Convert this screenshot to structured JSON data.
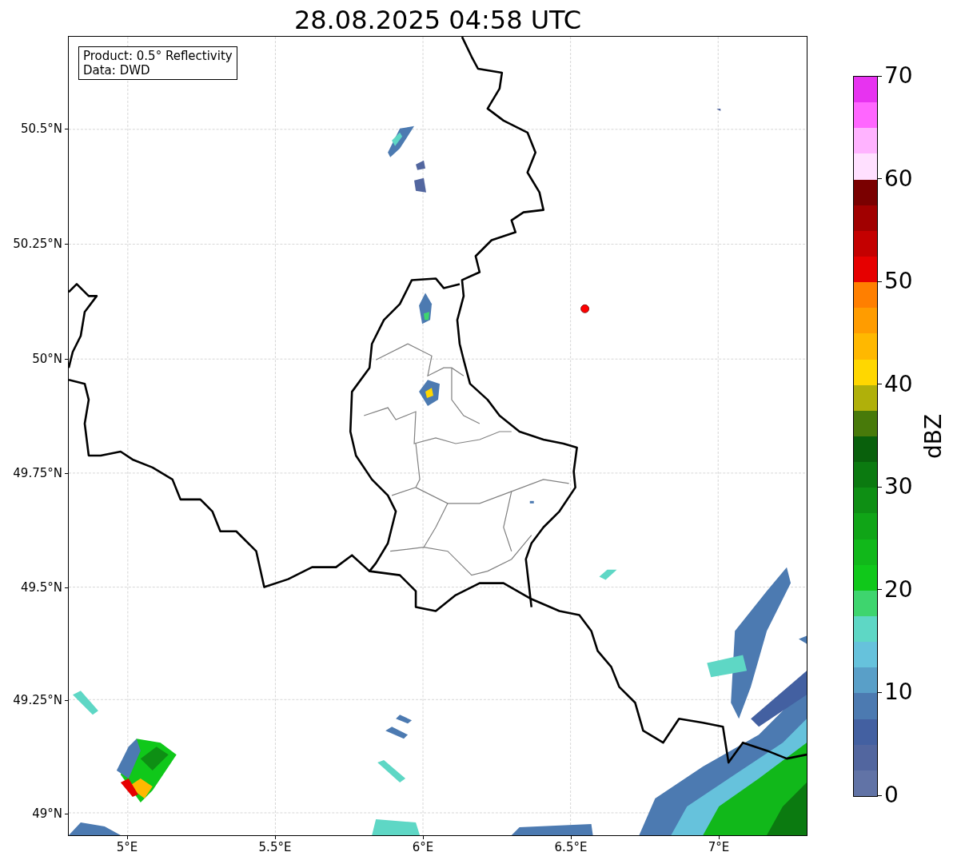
{
  "title": "28.08.2025 04:58 UTC",
  "info_box": [
    "Product: 0.5° Reflectivity",
    "Data: DWD"
  ],
  "x_ticks": [
    "5°E",
    "5.5°E",
    "6°E",
    "6.5°E",
    "7°E"
  ],
  "y_ticks": [
    "50.5°N",
    "50.25°N",
    "50°N",
    "49.75°N",
    "49.5°N",
    "49.25°N",
    "49°N"
  ],
  "colorbar": {
    "label": "dBZ",
    "ticks": [
      "70",
      "60",
      "50",
      "40",
      "30",
      "20",
      "10",
      "0"
    ],
    "segments": [
      {
        "color": "#6173a6"
      },
      {
        "color": "#52669f"
      },
      {
        "color": "#4360a1"
      },
      {
        "color": "#4c7ab1"
      },
      {
        "color": "#599fc8"
      },
      {
        "color": "#66c2dc"
      },
      {
        "color": "#5ed7c5"
      },
      {
        "color": "#3ed56e"
      },
      {
        "color": "#10c81a"
      },
      {
        "color": "#11b81a"
      },
      {
        "color": "#10a517"
      },
      {
        "color": "#0e8f14"
      },
      {
        "color": "#0b7a10"
      },
      {
        "color": "#09600c"
      },
      {
        "color": "#487a0a"
      },
      {
        "color": "#b0b00a"
      },
      {
        "color": "#ffd700"
      },
      {
        "color": "#ffb800"
      },
      {
        "color": "#ff9c00"
      },
      {
        "color": "#ff7f00"
      },
      {
        "color": "#e60000"
      },
      {
        "color": "#c40000"
      },
      {
        "color": "#a10000"
      },
      {
        "color": "#7a0000"
      },
      {
        "color": "#ffe0ff"
      },
      {
        "color": "#ffb3ff"
      },
      {
        "color": "#ff66ff"
      },
      {
        "color": "#e733f0"
      }
    ]
  }
}
